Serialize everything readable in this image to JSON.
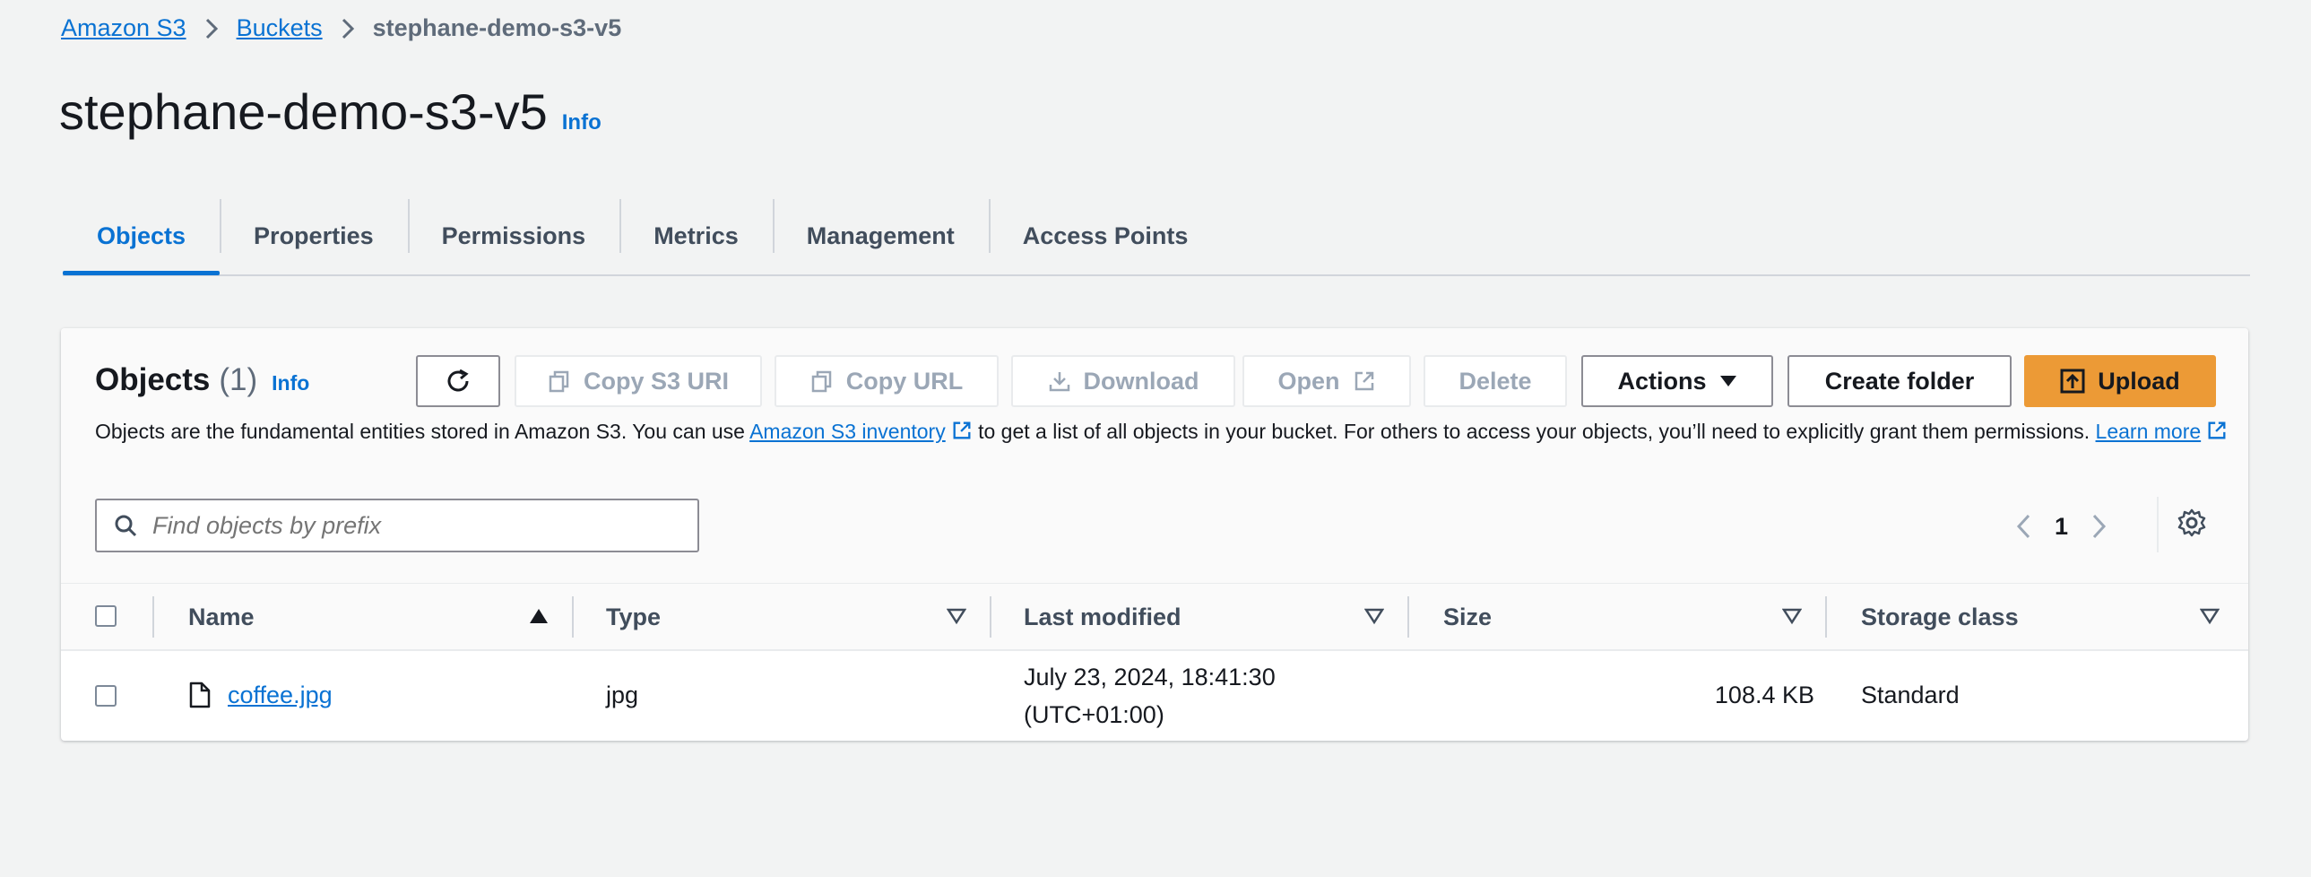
{
  "breadcrumb": {
    "items": [
      "Amazon S3",
      "Buckets"
    ],
    "current": "stephane-demo-s3-v5"
  },
  "page": {
    "title": "stephane-demo-s3-v5",
    "info": "Info"
  },
  "tabs": [
    "Objects",
    "Properties",
    "Permissions",
    "Metrics",
    "Management",
    "Access Points"
  ],
  "objects_panel": {
    "title": "Objects",
    "count": "(1)",
    "info": "Info",
    "buttons": {
      "copy_s3_uri": "Copy S3 URI",
      "copy_url": "Copy URL",
      "download": "Download",
      "open": "Open",
      "delete": "Delete",
      "actions": "Actions",
      "create_folder": "Create folder",
      "upload": "Upload"
    },
    "description": {
      "part1": "Objects are the fundamental entities stored in Amazon S3. You can use ",
      "link1": "Amazon S3 inventory",
      "part2": " to get a list of all objects in your bucket. For others to access your objects, you’ll need to explicitly grant them permissions. ",
      "link2": "Learn more"
    },
    "search": {
      "placeholder": "Find objects by prefix"
    },
    "pagination": {
      "page": "1"
    }
  },
  "table": {
    "columns": [
      "Name",
      "Type",
      "Last modified",
      "Size",
      "Storage class"
    ],
    "rows": [
      {
        "name": "coffee.jpg",
        "type": "jpg",
        "last_modified_date": "July 23, 2024, 18:41:30",
        "last_modified_tz": "(UTC+01:00)",
        "size": "108.4 KB",
        "storage_class": "Standard"
      }
    ]
  },
  "colors": {
    "link": "#0972d3",
    "primary_button": "#ec9a36",
    "page_background": "#f2f3f3",
    "disabled_text": "#9ba7b6"
  },
  "icons": {
    "breadcrumb_separator": "chevron-right-icon",
    "refresh": "refresh-icon",
    "copy": "copy-icon",
    "download": "download-icon",
    "external": "external-link-icon",
    "actions": "caret-down-icon",
    "upload": "upload-icon",
    "search": "search-icon",
    "settings": "gear-icon",
    "file": "file-icon"
  }
}
